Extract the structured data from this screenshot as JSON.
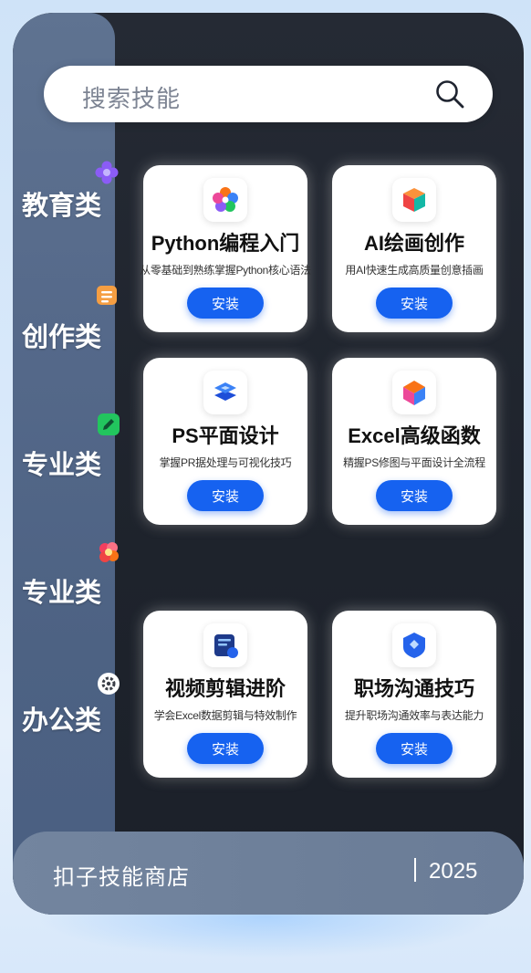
{
  "search": {
    "placeholder": "搜索技能",
    "icon": "search-icon"
  },
  "categories": [
    {
      "label": "教育类",
      "icon": "flower-icon",
      "color": "#8b5cf6"
    },
    {
      "label": "创作类",
      "icon": "notes-icon",
      "color": "#f59e42"
    },
    {
      "label": "专业类",
      "icon": "pencil-icon",
      "color": "#22c55e"
    },
    {
      "label": "专业类",
      "icon": "blossom-icon",
      "color": "#ef4444"
    },
    {
      "label": "办公类",
      "icon": "gear-icon",
      "color": "#ffffff"
    }
  ],
  "cards": [
    {
      "title": "Python编程入门",
      "desc": "从零基础到熟练掌握Python核心语法",
      "install": "安装",
      "icon": "petal-logo-icon"
    },
    {
      "title": "AI绘画创作",
      "desc": "用AI快速生成高质量创意插画",
      "install": "安装",
      "icon": "cube-logo-icon"
    },
    {
      "title": "PS平面设计",
      "desc": "掌握PR据处理与可视化技巧",
      "install": "安装",
      "icon": "layers-logo-icon"
    },
    {
      "title": "Excel高级函数",
      "desc": "精握PS修图与平面设计全流程",
      "install": "安装",
      "icon": "hex-cube-logo-icon"
    },
    {
      "title": "视频剪辑进阶",
      "desc": "学会Excel数据剪辑与特效制作",
      "install": "安装",
      "icon": "document-logo-icon"
    },
    {
      "title": "职场沟通技巧",
      "desc": "提升职场沟通效率与表达能力",
      "install": "安装",
      "icon": "shield-logo-icon"
    }
  ],
  "footer": {
    "store_name": "扣子技能商店",
    "year": "2025"
  }
}
